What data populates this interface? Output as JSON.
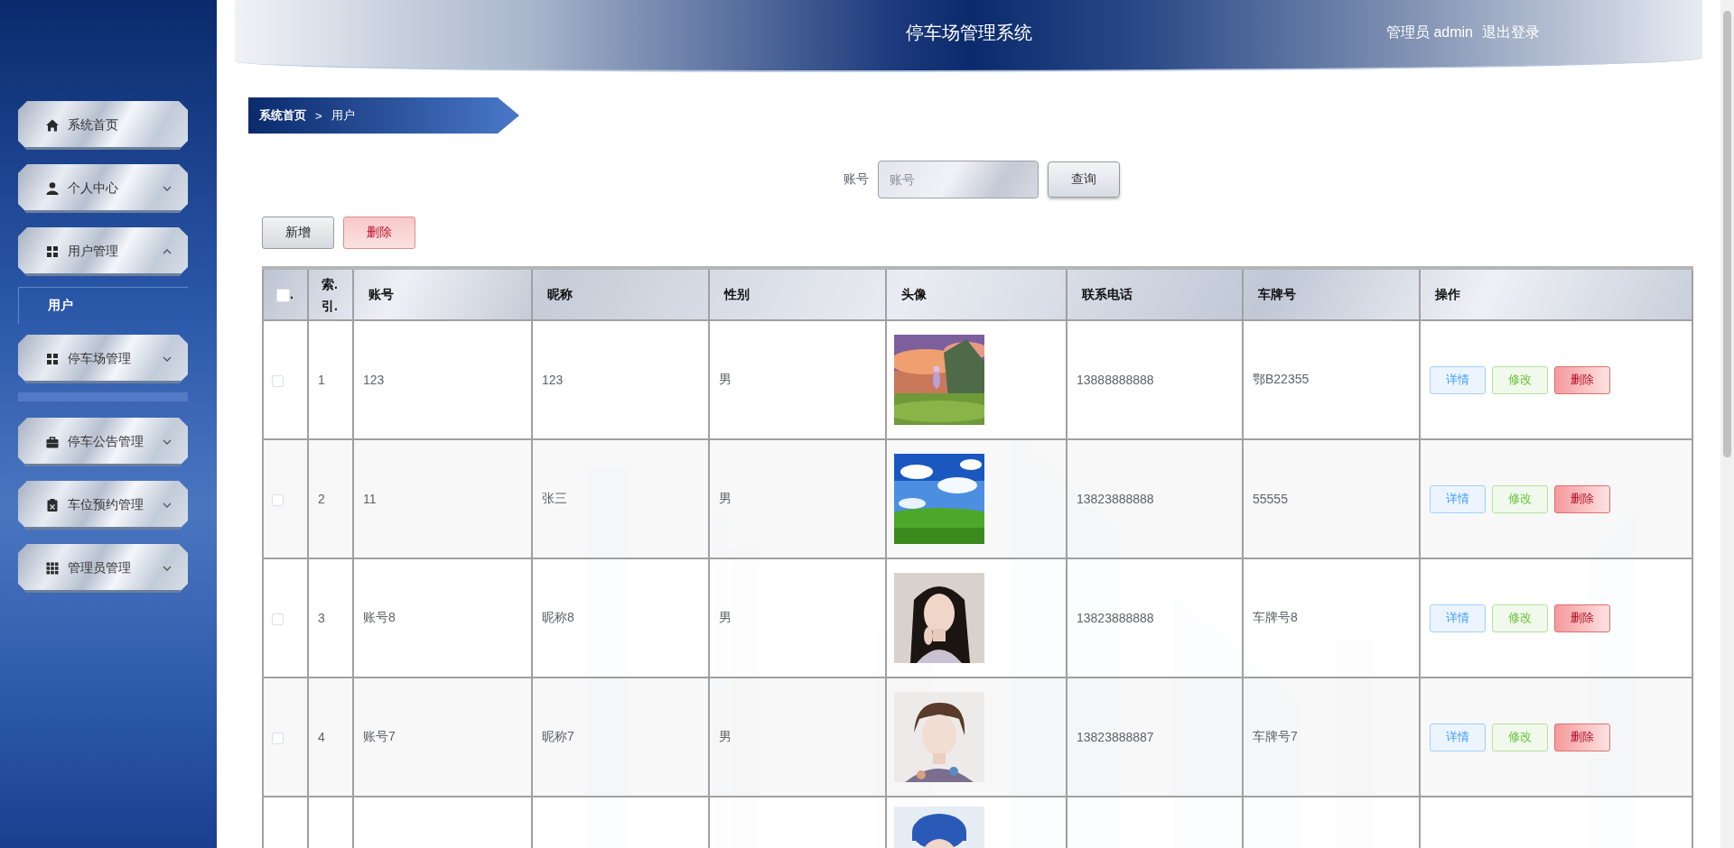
{
  "sidebar": {
    "items": [
      {
        "label": "系统首页",
        "kind": "link"
      },
      {
        "label": "个人中心",
        "kind": "menu",
        "expanded": false
      },
      {
        "label": "用户管理",
        "kind": "menu",
        "expanded": true,
        "children": [
          {
            "label": "用户",
            "selected": true
          }
        ]
      },
      {
        "label": "停车场管理",
        "kind": "menu",
        "expanded": false
      },
      {
        "label": "停车公告管理",
        "kind": "menu",
        "expanded": false
      },
      {
        "label": "车位预约管理",
        "kind": "menu",
        "expanded": false
      },
      {
        "label": "管理员管理",
        "kind": "menu",
        "expanded": false
      }
    ]
  },
  "header": {
    "title": "停车场管理系统",
    "user": "管理员 admin",
    "logout": "退出登录"
  },
  "breadcrumb": {
    "items": [
      "系统首页",
      "用户"
    ],
    "separator": ">"
  },
  "search": {
    "label": "账号",
    "placeholder": "账号",
    "button": "查询"
  },
  "actions": [
    {
      "label": "新增",
      "kind": "default"
    },
    {
      "label": "删除",
      "kind": "danger"
    }
  ],
  "table": {
    "columns": [
      {
        "label": ".",
        "kind": "check",
        "checked": false
      },
      {
        "label": "索.引."
      },
      {
        "label": "账号"
      },
      {
        "label": "昵称"
      },
      {
        "label": "性别"
      },
      {
        "label": "头像"
      },
      {
        "label": "联系电话"
      },
      {
        "label": "车牌号"
      },
      {
        "label": "操作"
      }
    ],
    "rows": [
      {
        "checked": false,
        "index": "1",
        "account": "123",
        "nickname": "123",
        "gender": "男",
        "avatar": {
          "kind": "picture"
        },
        "phone": "13888888888",
        "plate": "鄂B22355",
        "actions": [
          {
            "label": "详情",
            "kind": "info"
          },
          {
            "label": "修改",
            "kind": "edit"
          },
          {
            "label": "删除",
            "kind": "delete"
          }
        ]
      },
      {
        "checked": false,
        "index": "2",
        "account": "11",
        "nickname": "张三",
        "gender": "男",
        "avatar": {
          "kind": "picture"
        },
        "phone": "13823888888",
        "plate": "55555",
        "actions": [
          {
            "label": "详情",
            "kind": "info"
          },
          {
            "label": "修改",
            "kind": "edit"
          },
          {
            "label": "删除",
            "kind": "delete"
          }
        ]
      },
      {
        "checked": false,
        "index": "3",
        "account": "账号8",
        "nickname": "昵称8",
        "gender": "男",
        "avatar": {
          "kind": "picture"
        },
        "phone": "13823888888",
        "plate": "车牌号8",
        "actions": [
          {
            "label": "详情",
            "kind": "info"
          },
          {
            "label": "修改",
            "kind": "edit"
          },
          {
            "label": "删除",
            "kind": "delete"
          }
        ]
      },
      {
        "checked": false,
        "index": "4",
        "account": "账号7",
        "nickname": "昵称7",
        "gender": "男",
        "avatar": {
          "kind": "picture"
        },
        "phone": "13823888887",
        "plate": "车牌号7",
        "actions": [
          {
            "label": "详情",
            "kind": "info"
          },
          {
            "label": "修改",
            "kind": "edit"
          },
          {
            "label": "删除",
            "kind": "delete"
          }
        ]
      },
      {
        "avatar": {
          "kind": "picture"
        }
      }
    ]
  }
}
